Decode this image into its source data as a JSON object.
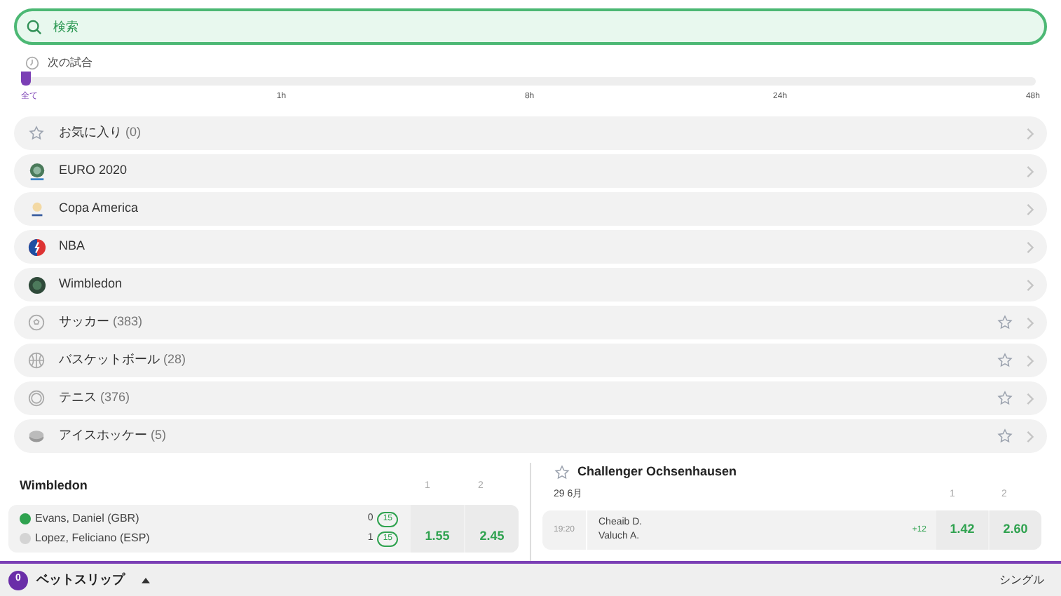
{
  "search": {
    "placeholder": "検索"
  },
  "next_matches": {
    "label": "次の試合"
  },
  "time_filter": {
    "level": 0,
    "ticks": [
      {
        "label": "全て",
        "selected": true
      },
      {
        "label": "1h",
        "selected": false
      },
      {
        "label": "8h",
        "selected": false
      },
      {
        "label": "24h",
        "selected": false
      },
      {
        "label": "48h",
        "selected": false
      }
    ]
  },
  "categories": [
    {
      "kind": "favorites",
      "name": "お気に入り",
      "count": "(0)"
    },
    {
      "kind": "league",
      "name": "EURO 2020"
    },
    {
      "kind": "league",
      "name": "Copa America"
    },
    {
      "kind": "league",
      "name": "NBA"
    },
    {
      "kind": "league",
      "name": "Wimbledon"
    },
    {
      "kind": "sport",
      "name": "サッカー",
      "count": "(383)"
    },
    {
      "kind": "sport",
      "name": "バスケットボール",
      "count": "(28)"
    },
    {
      "kind": "sport",
      "name": "テニス",
      "count": "(376)"
    },
    {
      "kind": "sport",
      "name": "アイスホッケー",
      "count": "(5)"
    }
  ],
  "left_event": {
    "title": "Wimbledon",
    "columns": [
      "1",
      "2"
    ],
    "match": {
      "players": [
        {
          "name": "Evans, Daniel (GBR)",
          "serving": true,
          "sets": "0",
          "points": "15"
        },
        {
          "name": "Lopez, Feliciano (ESP)",
          "serving": false,
          "sets": "1",
          "points": "15"
        }
      ],
      "odds": [
        "1.55",
        "2.45"
      ]
    }
  },
  "right_event": {
    "title": "Challenger Ochsenhausen",
    "date": "29 6月",
    "columns": [
      "1",
      "2"
    ],
    "match": {
      "time": "19:20",
      "players": [
        "Cheaib D.",
        "Valuch A."
      ],
      "more_markets": "+12",
      "odds": [
        "1.42",
        "2.60"
      ]
    }
  },
  "bet_slip": {
    "count": "0",
    "label": "ベットスリップ",
    "mode": "シングル"
  }
}
